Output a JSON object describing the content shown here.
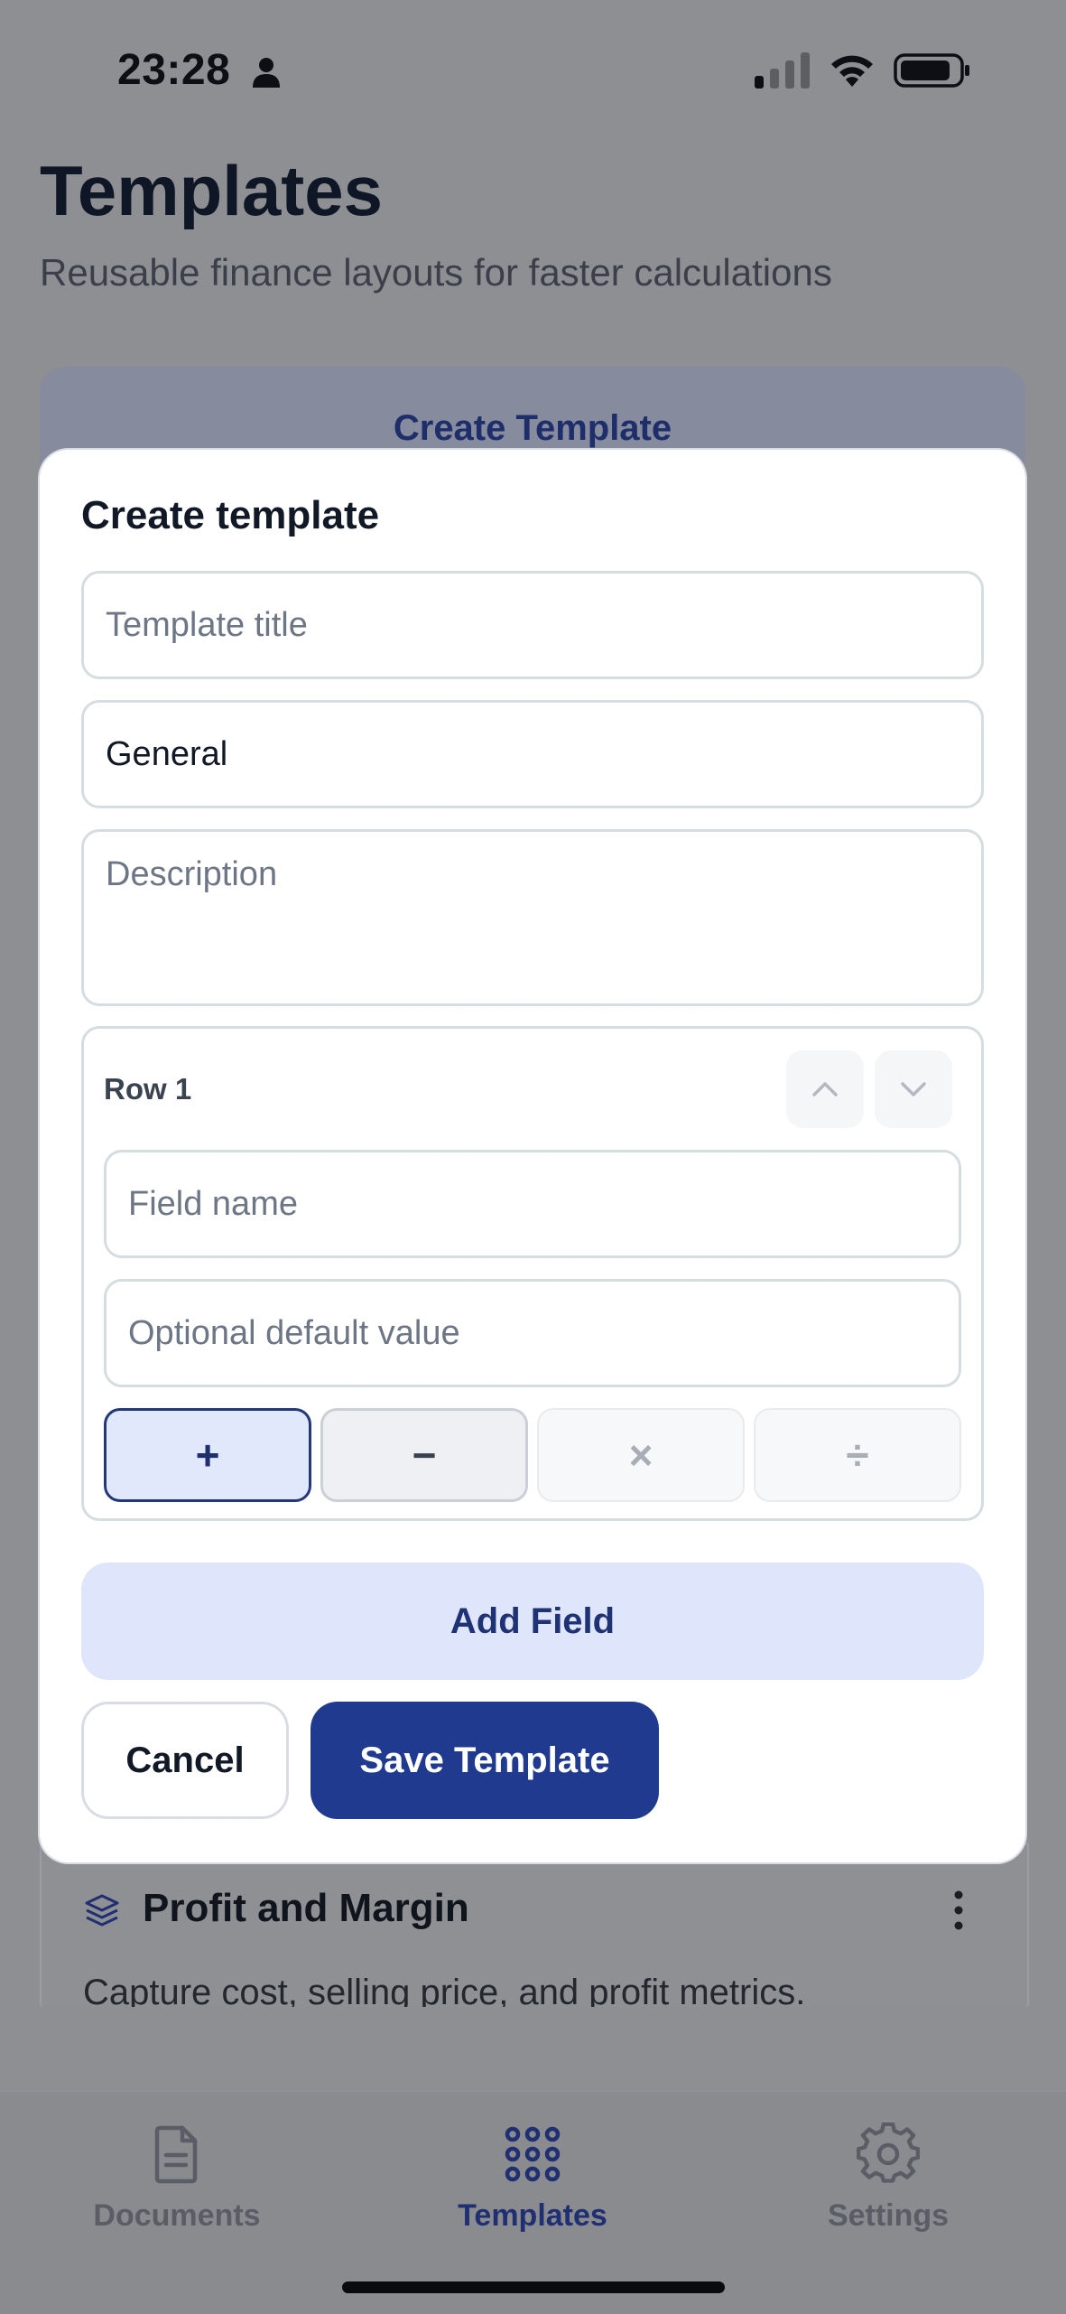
{
  "status_bar": {
    "time": "23:28"
  },
  "header": {
    "title": "Templates",
    "subtitle": "Reusable finance layouts for faster calculations"
  },
  "create_card": {
    "label": "Create Template"
  },
  "template_card": {
    "title": "Profit and Margin",
    "description": "Capture cost, selling price, and profit metrics."
  },
  "modal": {
    "title": "Create template",
    "title_field": {
      "value": "",
      "placeholder": "Template title"
    },
    "category_field": {
      "value": "General",
      "placeholder": ""
    },
    "description_field": {
      "value": "",
      "placeholder": "Description"
    },
    "row": {
      "label": "Row 1",
      "field_name": {
        "value": "",
        "placeholder": "Field name"
      },
      "default_value": {
        "value": "",
        "placeholder": "Optional default value"
      },
      "operators": [
        "+",
        "−",
        "×",
        "÷"
      ],
      "selected_operator": "+"
    },
    "add_field_label": "Add Field",
    "cancel_label": "Cancel",
    "save_label": "Save Template"
  },
  "bottom_nav": {
    "items": [
      {
        "label": "Documents",
        "icon": "document-icon"
      },
      {
        "label": "Templates",
        "icon": "grid-icon",
        "active": true
      },
      {
        "label": "Settings",
        "icon": "gear-icon"
      }
    ]
  },
  "colors": {
    "accent": "#1f3a8e",
    "accent_light": "#dfe6fc",
    "overlay": "#8e8f93"
  }
}
